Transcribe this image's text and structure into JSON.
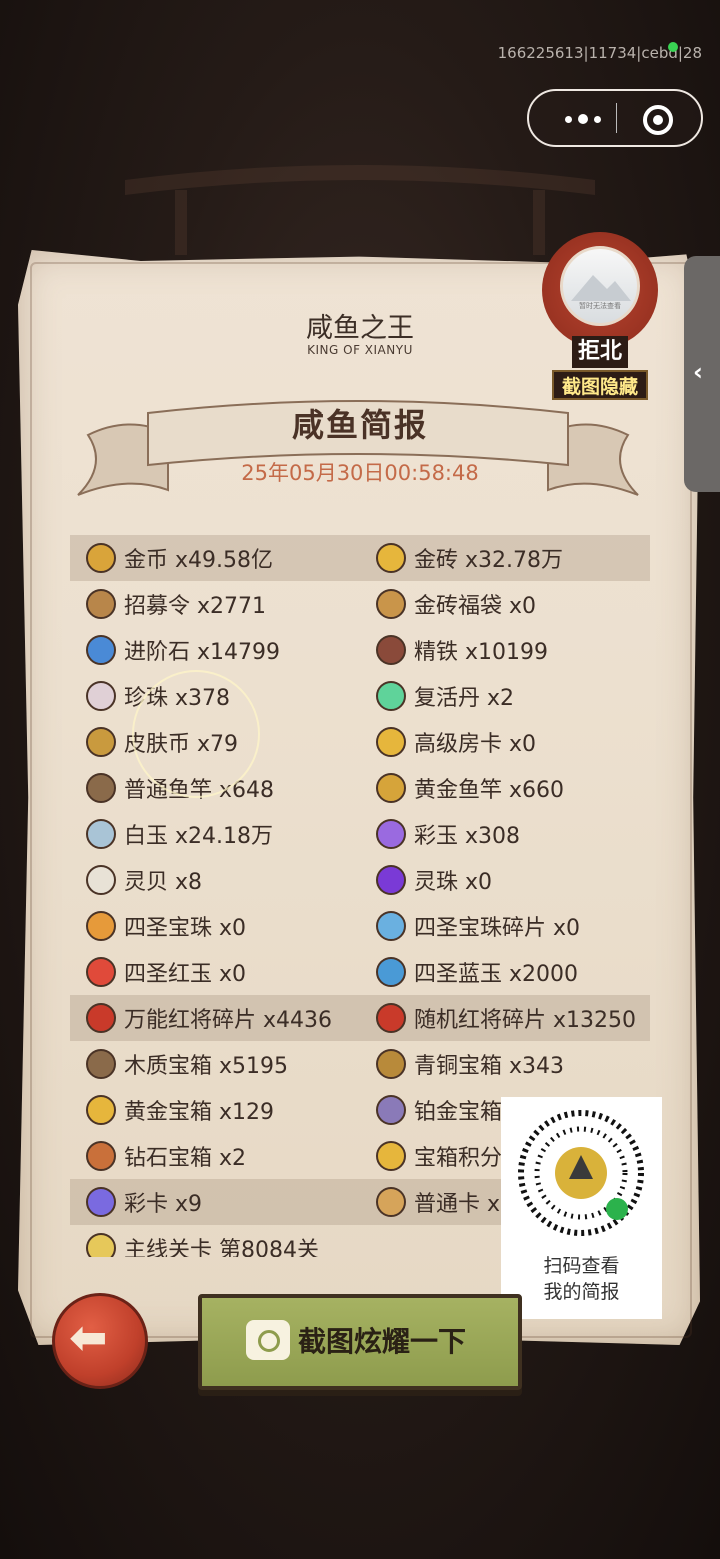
{
  "status": {
    "id_text": "166225613|11734|cebd|28"
  },
  "capsule": {
    "more_icon": "more-dots-icon",
    "close_icon": "target-icon"
  },
  "header": {
    "title_cn": "咸鱼之王",
    "title_en": "KING OF XIANYU"
  },
  "banner": {
    "title": "咸鱼简报",
    "date": "25年05月30日00:58:48"
  },
  "seal": {
    "avatar_caption": "暂时无法查看",
    "name": "拒北",
    "hide_label": "截图隐藏"
  },
  "side_tab": {
    "arrow": "‹"
  },
  "items": [
    {
      "left": "金币 x49.58亿",
      "right": "金砖 x32.78万",
      "hl": true,
      "lc": "#d9a43a",
      "rc": "#e6b63c"
    },
    {
      "left": "招募令 x2771",
      "right": "金砖福袋 x0",
      "hl": false,
      "lc": "#b8864a",
      "rc": "#c9954a"
    },
    {
      "left": "进阶石 x14799",
      "right": "精铁 x10199",
      "hl": false,
      "lc": "#4a8ad6",
      "rc": "#8a4a3a"
    },
    {
      "left": "珍珠 x378",
      "right": "复活丹 x2",
      "hl": false,
      "lc": "#e0d0d6",
      "rc": "#5fd39a"
    },
    {
      "left": "皮肤币 x79",
      "right": "高级房卡 x0",
      "hl": false,
      "lc": "#c99a3e",
      "rc": "#e6b63c"
    },
    {
      "left": "普通鱼竿 x648",
      "right": "黄金鱼竿 x660",
      "hl": false,
      "lc": "#8a6a4a",
      "rc": "#d6a43a"
    },
    {
      "left": "白玉 x24.18万",
      "right": "彩玉 x308",
      "hl": false,
      "lc": "#a9c4d6",
      "rc": "#9a6ae0"
    },
    {
      "left": "灵贝 x8",
      "right": "灵珠 x0",
      "hl": false,
      "lc": "#e8e2d6",
      "rc": "#7a3ad6"
    },
    {
      "left": "四圣宝珠 x0",
      "right": "四圣宝珠碎片 x0",
      "hl": false,
      "lc": "#e69a3a",
      "rc": "#6ab0e0"
    },
    {
      "left": "四圣红玉 x0",
      "right": "四圣蓝玉 x2000",
      "hl": false,
      "lc": "#e04a3a",
      "rc": "#4a9ad6"
    },
    {
      "left": "万能红将碎片 x4436",
      "right": "随机红将碎片 x13250",
      "hl": true,
      "lc": "#c93a2a",
      "rc": "#c93a2a"
    },
    {
      "left": "木质宝箱 x5195",
      "right": "青铜宝箱 x343",
      "hl": false,
      "lc": "#8a6a4a",
      "rc": "#b88a3a"
    },
    {
      "left": "黄金宝箱 x129",
      "right": "铂金宝箱",
      "hl": false,
      "lc": "#e6b63c",
      "rc": "#8a7ab8"
    },
    {
      "left": "钻石宝箱 x2",
      "right": "宝箱积分",
      "hl": false,
      "lc": "#c9703a",
      "rc": "#e6b63c"
    },
    {
      "left": "彩卡 x9",
      "right": "普通卡 x",
      "hl": true,
      "lc": "#7a6ae0",
      "rc": "#d6a45a"
    },
    {
      "left": "主线关卡 第8084关",
      "right": "",
      "hl": false,
      "lc": "#e6c85a",
      "rc": ""
    }
  ],
  "qr": {
    "text_line1": "扫码查看",
    "text_line2": "我的简报"
  },
  "buttons": {
    "back_icon": "back-arrow-icon",
    "screenshot_label": "截图炫耀一下"
  }
}
